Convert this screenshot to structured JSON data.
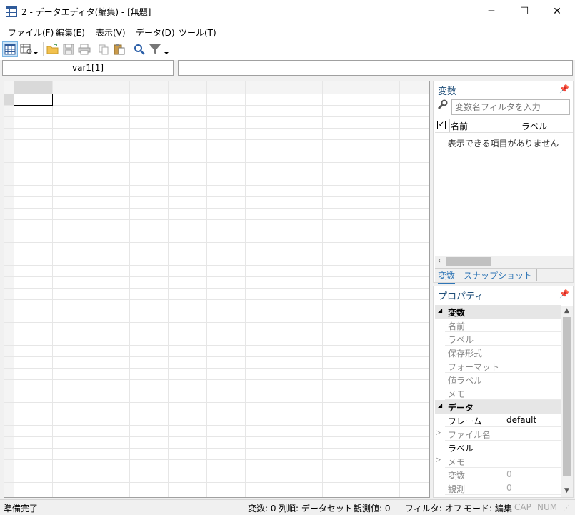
{
  "window": {
    "title": "2 - データエディタ(編集) - [無題]",
    "minimize_glyph": "─",
    "maximize_glyph": "☐",
    "close_glyph": "✕"
  },
  "menu": [
    "ファイル(F)",
    "編集(E)",
    "表示(V)",
    "データ(D)",
    "ツール(T)"
  ],
  "toolbar": {
    "icons": [
      "data-grid-icon",
      "table-view-icon",
      "open-folder-icon",
      "save-icon",
      "print-icon",
      "copy-icon",
      "paste-icon",
      "search-icon",
      "filter-icon"
    ]
  },
  "cell_reference": "var1[1]",
  "cell_value": "",
  "variables_panel": {
    "title": "変数",
    "filter_placeholder": "変数名フィルタを入力",
    "columns": [
      "名前",
      "ラベル"
    ],
    "empty_message": "表示できる項目がありません",
    "tabs": [
      "変数",
      "スナップショット"
    ]
  },
  "properties_panel": {
    "title": "プロパティ",
    "categories": [
      {
        "name": "変数",
        "rows": [
          {
            "name": "名前",
            "value": ""
          },
          {
            "name": "ラベル",
            "value": ""
          },
          {
            "name": "保存形式",
            "value": ""
          },
          {
            "name": "フォーマット",
            "value": ""
          },
          {
            "name": "値ラベル",
            "value": ""
          },
          {
            "name": "メモ",
            "value": ""
          }
        ]
      },
      {
        "name": "データ",
        "rows": [
          {
            "name": "フレーム",
            "value": "default"
          },
          {
            "name": "ファイル名",
            "value": ""
          },
          {
            "name": "ラベル",
            "value": ""
          },
          {
            "name": "メモ",
            "value": ""
          },
          {
            "name": "変数",
            "value": "0"
          },
          {
            "name": "観測",
            "value": "0"
          }
        ]
      }
    ]
  },
  "status": {
    "left": "準備完了",
    "variables": "変数: 0",
    "order": "列順: データセット",
    "observations": "観測値: 0",
    "filter": "フィルタ: オフ",
    "mode": "モード: 編集",
    "cap": "CAP",
    "num": "NUM"
  },
  "colors": {
    "accent": "#1f4e79",
    "selected_tab": "#2e75b6"
  }
}
